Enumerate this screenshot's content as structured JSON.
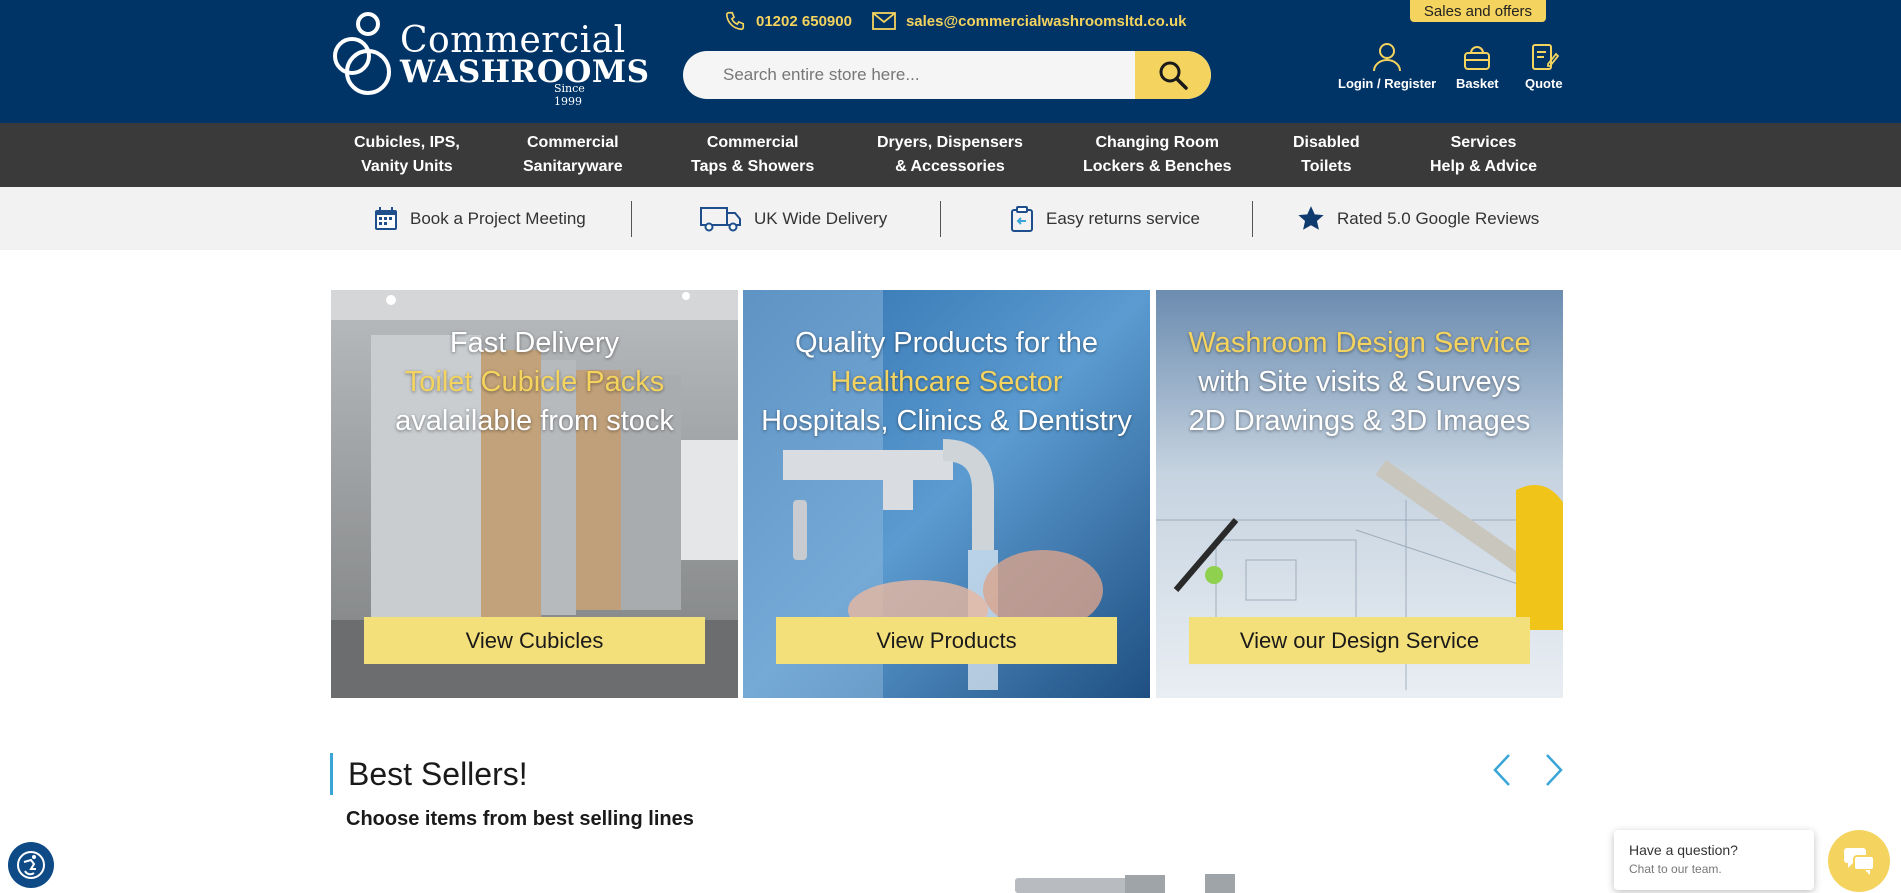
{
  "header": {
    "logo": {
      "line1": "Commercial",
      "line2": "WASHROOMS",
      "line3": "Since 1999"
    },
    "phone": "01202 650900",
    "email": "sales@commercialwashroomsltd.co.uk",
    "search_placeholder": "Search entire store here...",
    "sales_label": "Sales and offers",
    "login_label": "Login / Register",
    "basket_label": "Basket",
    "quote_label": "Quote"
  },
  "nav": {
    "items": [
      {
        "line1": "Cubicles, IPS,",
        "line2": "Vanity Units"
      },
      {
        "line1": "Commercial",
        "line2": "Sanitaryware"
      },
      {
        "line1": "Commercial",
        "line2": "Taps & Showers"
      },
      {
        "line1": "Dryers, Dispensers",
        "line2": "& Accessories"
      },
      {
        "line1": "Changing Room",
        "line2": "Lockers & Benches"
      },
      {
        "line1": "Disabled",
        "line2": "Toilets"
      },
      {
        "line1": "Services",
        "line2": "Help & Advice"
      }
    ]
  },
  "usp": {
    "items": [
      {
        "label": "Book a Project Meeting",
        "icon": "calendar-icon"
      },
      {
        "label": "UK Wide Delivery",
        "icon": "truck-icon"
      },
      {
        "label": "Easy returns service",
        "icon": "returns-icon"
      },
      {
        "label": "Rated 5.0 Google Reviews",
        "icon": "star-icon"
      }
    ]
  },
  "promos": [
    {
      "line1": "Fast Delivery",
      "line2": "Toilet Cubicle Packs",
      "line3": "avalailable from stock",
      "cta": "View Cubicles"
    },
    {
      "line1": "Quality Products for the",
      "line2": "Healthcare Sector",
      "line3": "Hospitals, Clinics & Dentistry",
      "cta": "View Products"
    },
    {
      "line1": "Washroom Design Service",
      "line2": "with Site visits & Surveys",
      "line3": "2D Drawings & 3D Images",
      "cta": "View our Design Service"
    }
  ],
  "best_sellers": {
    "title": "Best Sellers!",
    "subtitle": "Choose items from best selling lines"
  },
  "chat": {
    "title": "Have a question?",
    "subtitle": "Chat to our team."
  },
  "colors": {
    "header_bg": "#003366",
    "nav_bg": "#3a3a3a",
    "accent_yellow": "#f4d35e",
    "cta_yellow": "#f4e07a",
    "accent_blue": "#3aa6d8"
  }
}
